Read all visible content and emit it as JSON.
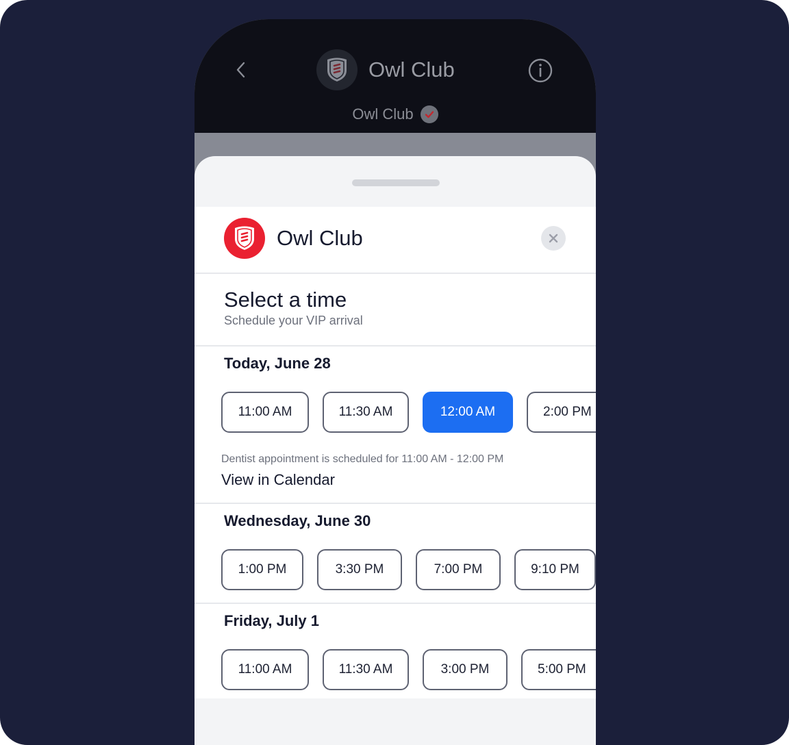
{
  "header": {
    "title": "Owl Club",
    "subtitle": "Owl Club"
  },
  "club": {
    "name": "Owl Club"
  },
  "screen": {
    "title": "Select a time",
    "subtitle": "Schedule your VIP arrival"
  },
  "days": [
    {
      "label": "Today, June 28",
      "slots": [
        "11:00 AM",
        "11:30 AM",
        "12:00 AM",
        "2:00 PM"
      ],
      "selected_index": 2
    },
    {
      "label": "Wednesday, June 30",
      "slots": [
        "1:00 PM",
        "3:30 PM",
        "7:00 PM",
        "9:10 PM"
      ]
    },
    {
      "label": "Friday, July 1",
      "slots": [
        "11:00 AM",
        "11:30 AM",
        "3:00 PM",
        "5:00 PM"
      ]
    }
  ],
  "conflict": {
    "note": "Dentist appointment is scheduled for 11:00 AM - 12:00 PM",
    "link": "View in Calendar"
  },
  "colors": {
    "background": "#1b1f3a",
    "accent": "#1c6ef2",
    "brand": "#ea2131"
  }
}
